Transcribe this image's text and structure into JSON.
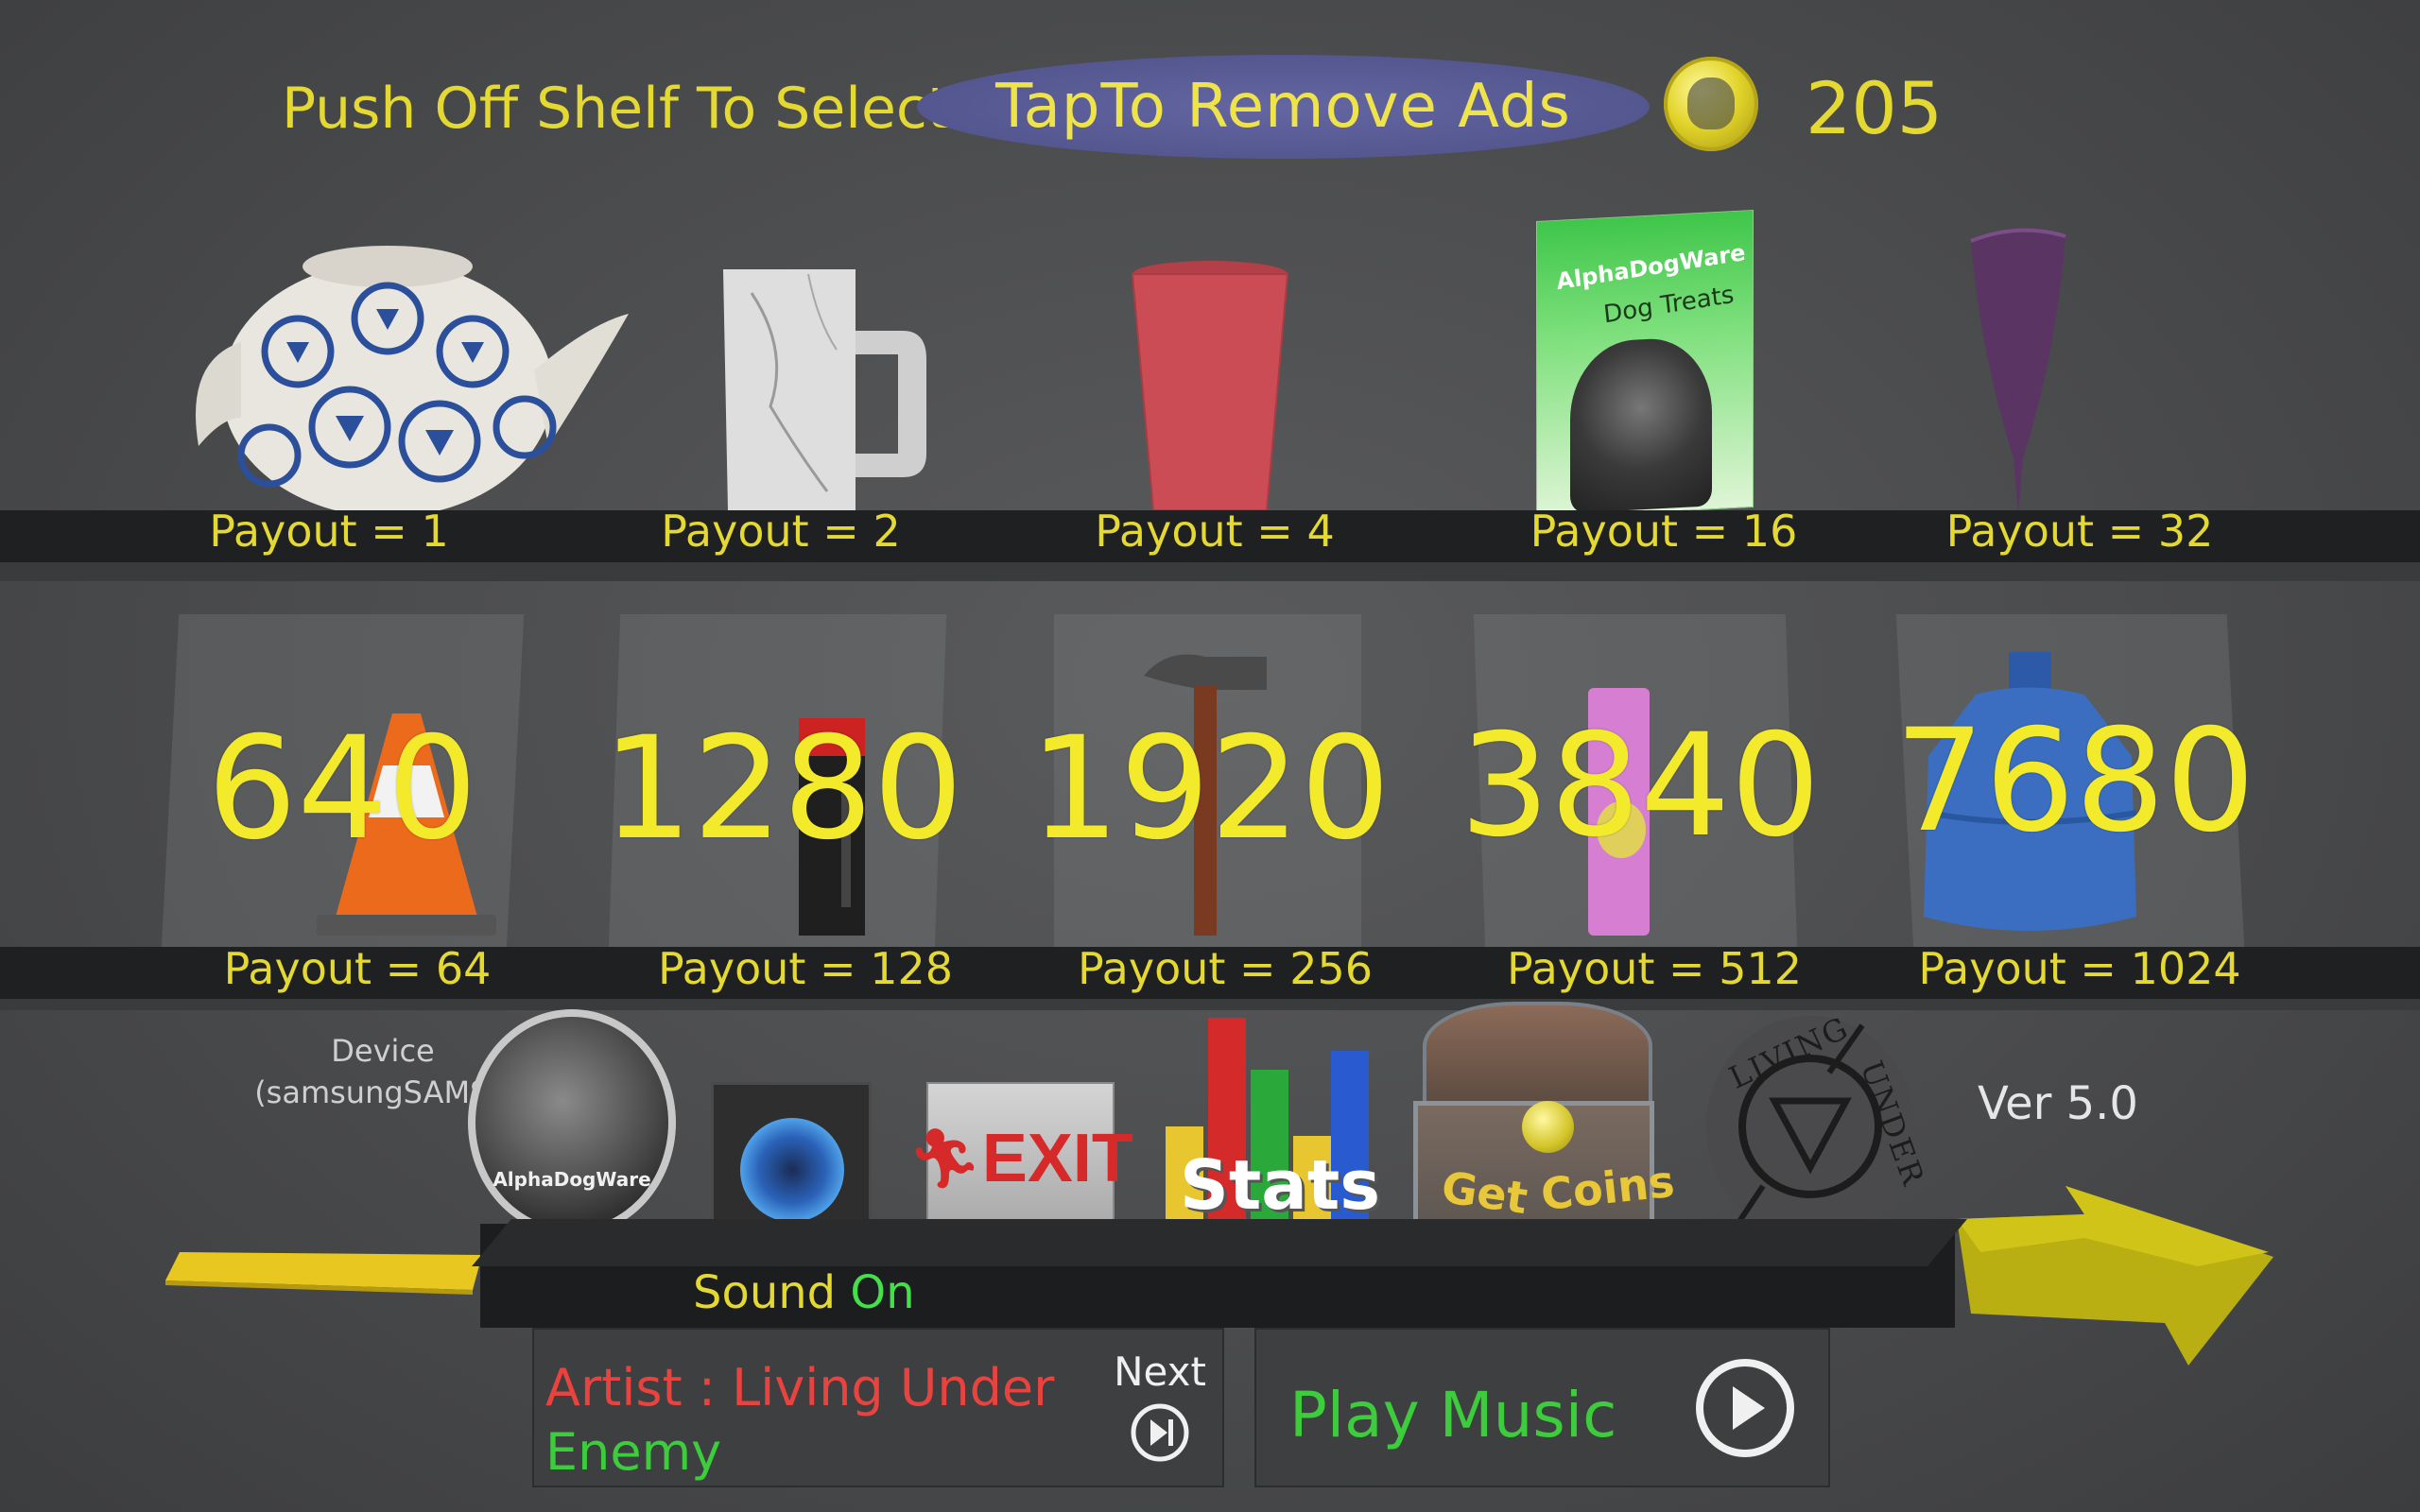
{
  "header": {
    "instruction": "Push Off Shelf To Select",
    "remove_ads": "TapTo Remove Ads",
    "coin_count": "205"
  },
  "top_shelf": [
    {
      "item": "teapot",
      "payout": "Payout = 1"
    },
    {
      "item": "marble mug",
      "payout": "Payout = 2"
    },
    {
      "item": "red cup",
      "payout": "Payout = 4"
    },
    {
      "item": "dog treats box",
      "payout": "Payout = 16",
      "box_title": "AlphaDogWare",
      "box_sub": "Dog Treats"
    },
    {
      "item": "wine glass",
      "payout": "Payout = 32"
    }
  ],
  "bottom_shelf": [
    {
      "item": "traffic cone",
      "price": "640",
      "payout": "Payout = 64"
    },
    {
      "item": "battery",
      "price": "1280",
      "payout": "Payout = 128"
    },
    {
      "item": "hammer",
      "price": "1920",
      "payout": "Payout = 256"
    },
    {
      "item": "snack can",
      "price": "3840",
      "payout": "Payout = 512"
    },
    {
      "item": "water jug",
      "price": "7680",
      "payout": "Payout = 1024"
    }
  ],
  "menu": {
    "device_label": "Device",
    "device_name": "(samsungSAMSU",
    "logo_label": "AlphaDogWare",
    "sound_label": "Sound",
    "sound_state": "On",
    "exit_label": "EXIT",
    "stats_label": "Stats",
    "get_coins_1": "Get",
    "get_coins_2": "Coins",
    "living_under_1": "LIVING",
    "living_under_2": "UNDER",
    "version": "Ver 5.0"
  },
  "music": {
    "artist": "Artist : Living Under",
    "track": "Enemy",
    "next_label": "Next",
    "play_label": "Play Music"
  },
  "colors": {
    "accent_yellow": "#e4d832",
    "artist_red": "#e8433f",
    "track_green": "#3ccc3c"
  }
}
